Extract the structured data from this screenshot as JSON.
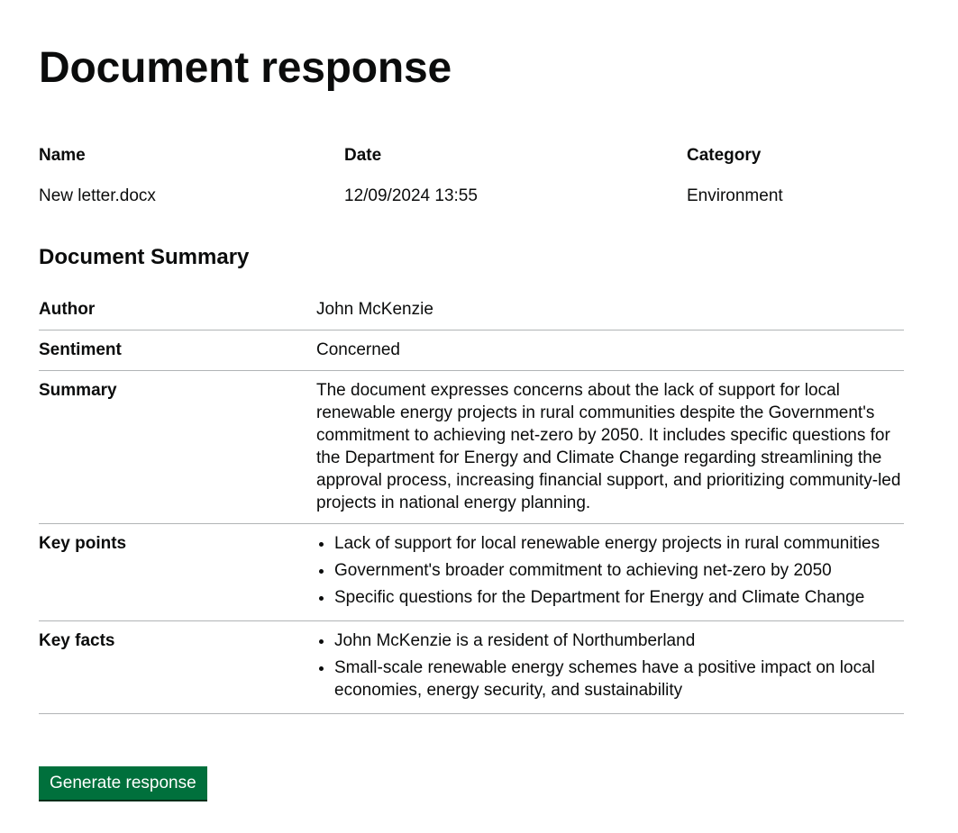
{
  "page": {
    "title": "Document response"
  },
  "meta": {
    "headers": [
      "Name",
      "Date",
      "Category"
    ],
    "values": [
      "New letter.docx",
      "12/09/2024 13:55",
      "Environment"
    ]
  },
  "summary": {
    "title": "Document Summary",
    "author_label": "Author",
    "author_value": "John McKenzie",
    "sentiment_label": "Sentiment",
    "sentiment_value": "Concerned",
    "summary_label": "Summary",
    "summary_value": "The document expresses concerns about the lack of support for local renewable energy projects in rural communities despite the Government's commitment to achieving net-zero by 2050. It includes specific questions for the Department for Energy and Climate Change regarding streamlining the approval process, increasing financial support, and prioritizing community-led projects in national energy planning.",
    "key_points_label": "Key points",
    "key_points": [
      "Lack of support for local renewable energy projects in rural communities",
      "Government's broader commitment to achieving net-zero by 2050",
      "Specific questions for the Department for Energy and Climate Change"
    ],
    "key_facts_label": "Key facts",
    "key_facts": [
      "John McKenzie is a resident of Northumberland",
      "Small-scale renewable energy schemes have a positive impact on local economies, energy security, and sustainability"
    ]
  },
  "actions": {
    "generate_label": "Generate response"
  },
  "colors": {
    "button_green": "#00703c",
    "divider": "#b1b4b6",
    "text": "#0b0c0c"
  }
}
